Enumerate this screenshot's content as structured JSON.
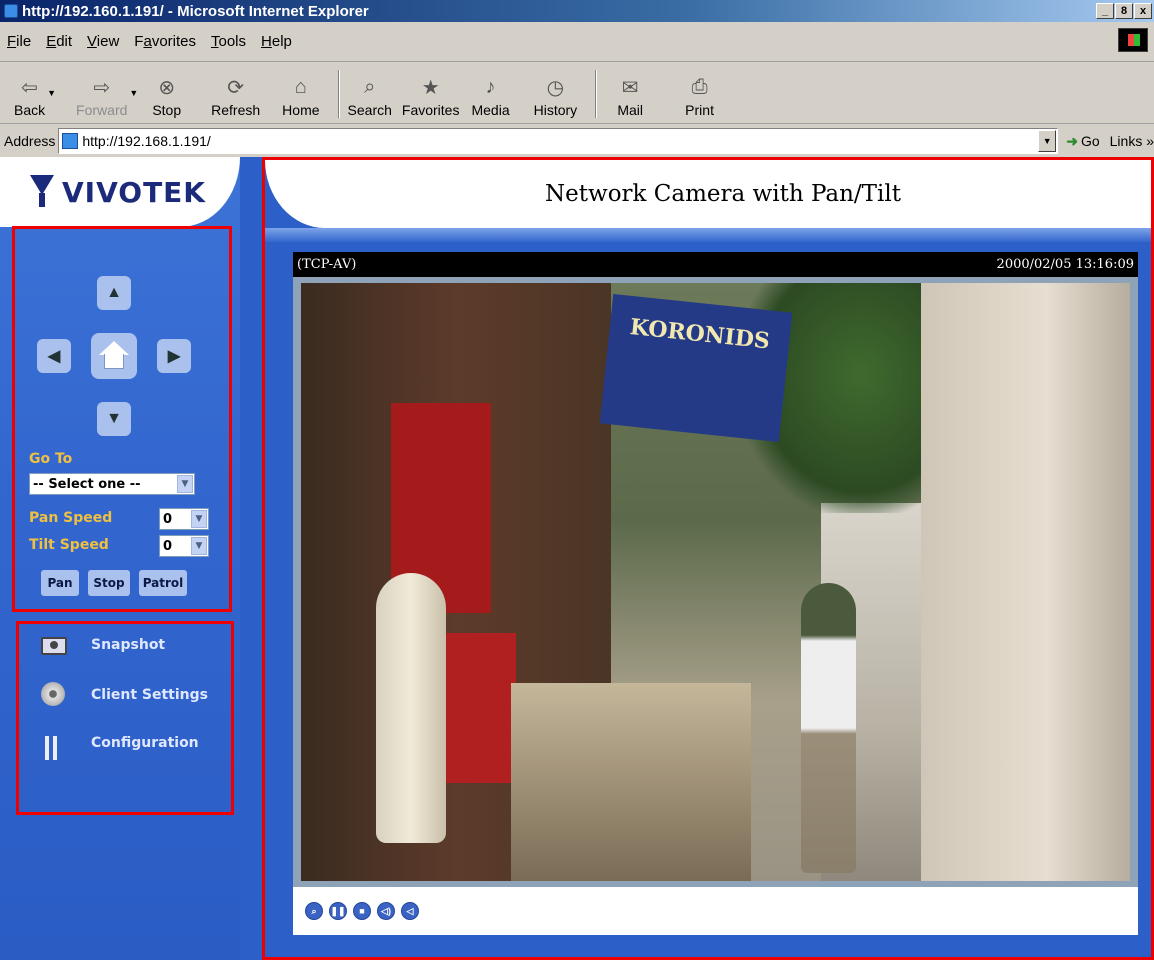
{
  "window": {
    "title": "http://192.160.1.191/ - Microsoft Internet Explorer",
    "controls": [
      "_",
      "8",
      "x"
    ]
  },
  "menubar": {
    "items": [
      {
        "underline": "F",
        "rest": "ile"
      },
      {
        "underline": "E",
        "rest": "dit"
      },
      {
        "underline": "V",
        "rest": "iew"
      },
      {
        "pre": "F",
        "underline": "a",
        "rest": "vorites"
      },
      {
        "underline": "T",
        "rest": "ools"
      },
      {
        "underline": "H",
        "rest": "elp"
      }
    ]
  },
  "toolbar": {
    "back": "Back",
    "forward": "Forward",
    "stop": "Stop",
    "refresh": "Refresh",
    "home": "Home",
    "search": "Search",
    "favorites": "Favorites",
    "media": "Media",
    "history": "History",
    "mail": "Mail",
    "print": "Print"
  },
  "addressbar": {
    "label": "Address",
    "url": "http://192.168.1.191/",
    "go": "Go",
    "links": "Links »"
  },
  "sidebar": {
    "logo": "VIVOTEK",
    "ptz": {
      "goto_label": "Go To",
      "goto_value": "-- Select one --",
      "pan_speed_label": "Pan Speed",
      "pan_speed_value": "0",
      "tilt_speed_label": "Tilt Speed",
      "tilt_speed_value": "0",
      "pan_button": "Pan",
      "stop_button": "Stop",
      "patrol_button": "Patrol"
    },
    "tools": {
      "snapshot": "Snapshot",
      "client_settings": "Client Settings",
      "configuration": "Configuration"
    }
  },
  "main": {
    "title": "Network Camera with Pan/Tilt",
    "stream_label": "(TCP-AV)",
    "timestamp": "2000/02/05 13:16:09",
    "sign_text": "KORONIDS"
  },
  "colors": {
    "page_blue": "#2c5fc8",
    "highlight_red": "#e00000",
    "label_gold": "#f0c040"
  }
}
